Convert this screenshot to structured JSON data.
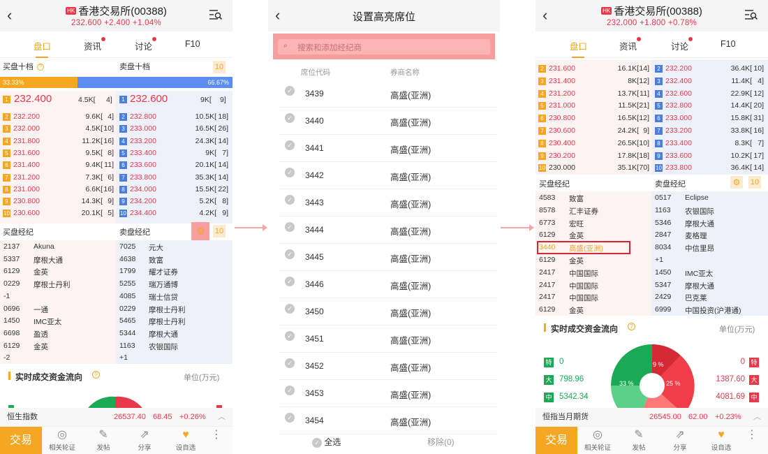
{
  "p1": {
    "title": "香港交易所(00388)",
    "hk": "HK",
    "price": "232.600",
    "change": "+2.400",
    "pct": "+1.04%",
    "tabs": [
      "盘口",
      "资讯",
      "讨论",
      "F10"
    ],
    "bid10": "买盘十档",
    "ask10": "卖盘十档",
    "levels": "10",
    "bidpct": "33.33%",
    "askpct": "66.67%",
    "top": {
      "bid": "232.400",
      "bidvol": "4.5K[",
      "bidn": "4]",
      "ask": "232.600",
      "askvol": "9K[",
      "askn": "9]"
    },
    "bids": [
      [
        "2",
        "232.200",
        "9.6K[",
        "4]"
      ],
      [
        "3",
        "232.000",
        "4.5K[",
        "10]"
      ],
      [
        "4",
        "231.800",
        "11.2K[",
        "16]"
      ],
      [
        "5",
        "231.600",
        "9.5K[",
        "8]"
      ],
      [
        "6",
        "231.400",
        "9.4K[",
        "11]"
      ],
      [
        "7",
        "231.200",
        "7.3K[",
        "6]"
      ],
      [
        "8",
        "231.000",
        "6.6K[",
        "16]"
      ],
      [
        "9",
        "230.800",
        "14.3K[",
        "9]"
      ],
      [
        "10",
        "230.600",
        "20.1K[",
        "5]"
      ]
    ],
    "asks": [
      [
        "2",
        "232.800",
        "10.5K[",
        "18]"
      ],
      [
        "3",
        "233.000",
        "16.5K[",
        "26]"
      ],
      [
        "4",
        "233.200",
        "24.3K[",
        "14]"
      ],
      [
        "5",
        "233.400",
        "9K[",
        "7]"
      ],
      [
        "6",
        "233.600",
        "20.1K[",
        "14]"
      ],
      [
        "7",
        "233.800",
        "35.3K[",
        "14]"
      ],
      [
        "8",
        "234.000",
        "15.5K[",
        "22]"
      ],
      [
        "9",
        "234.200",
        "5.2K[",
        "8]"
      ],
      [
        "10",
        "234.400",
        "4.2K[",
        "9]"
      ]
    ],
    "broker_bid": "买盘经纪",
    "broker_ask": "卖盘经纪",
    "bidBrokers": [
      [
        "2137",
        "Akuna"
      ],
      [
        "5337",
        "摩根大通"
      ],
      [
        "6129",
        "金英"
      ],
      [
        "0229",
        "摩根士丹利"
      ],
      [
        "-1",
        ""
      ],
      [
        "0696",
        "一通"
      ],
      [
        "1450",
        "IMC亚太"
      ],
      [
        "6698",
        "盈透"
      ],
      [
        "6129",
        "金英"
      ],
      [
        "-2",
        ""
      ]
    ],
    "askBrokers": [
      [
        "7025",
        "元大"
      ],
      [
        "4638",
        "致富"
      ],
      [
        "1799",
        "耀才证券"
      ],
      [
        "5255",
        "瑞万通博"
      ],
      [
        "4085",
        "瑞士信贷"
      ],
      [
        "0229",
        "摩根士丹利"
      ],
      [
        "5465",
        "摩根士丹利"
      ],
      [
        "5344",
        "摩根大通"
      ],
      [
        "1163",
        "农银国际"
      ],
      [
        "+1",
        ""
      ]
    ],
    "flow": "实时成交资金流向",
    "unit": "单位(万元)",
    "ticker": {
      "name": "恒生指数",
      "val": "26537.40",
      "chg": "68.45",
      "pct": "+0.26%"
    },
    "toolbar": {
      "trade": "交易",
      "items": [
        "相关轮证",
        "发帖",
        "分享",
        "设自选"
      ]
    }
  },
  "p2": {
    "title": "设置高亮席位",
    "search": "搜索和添加经纪商",
    "col1": "席位代码",
    "col2": "券商名称",
    "rows": [
      [
        "3439",
        "高盛(亚洲)"
      ],
      [
        "3440",
        "高盛(亚洲)"
      ],
      [
        "3441",
        "高盛(亚洲)"
      ],
      [
        "3442",
        "高盛(亚洲)"
      ],
      [
        "3443",
        "高盛(亚洲)"
      ],
      [
        "3444",
        "高盛(亚洲)"
      ],
      [
        "3445",
        "高盛(亚洲)"
      ],
      [
        "3446",
        "高盛(亚洲)"
      ],
      [
        "3450",
        "高盛(亚洲)"
      ],
      [
        "3451",
        "高盛(亚洲)"
      ],
      [
        "3452",
        "高盛(亚洲)"
      ],
      [
        "3453",
        "高盛(亚洲)"
      ],
      [
        "3454",
        "高盛(亚洲)"
      ]
    ],
    "selectall": "全选",
    "remove": "移除(0)"
  },
  "p3": {
    "title": "香港交易所(00388)",
    "hk": "HK",
    "price": "232.000",
    "change": "+1.800",
    "pct": "+0.78%",
    "tabs": [
      "盘口",
      "资讯",
      "讨论",
      "F10"
    ],
    "bids": [
      [
        "2",
        "231.600",
        "16.1K[",
        "14]"
      ],
      [
        "3",
        "231.400",
        "8K[",
        "12]"
      ],
      [
        "4",
        "231.200",
        "13.7K[",
        "11]"
      ],
      [
        "5",
        "231.000",
        "11.5K[",
        "21]"
      ],
      [
        "6",
        "230.800",
        "16.5K[",
        "12]"
      ],
      [
        "7",
        "230.600",
        "24.2K[",
        "9]"
      ],
      [
        "8",
        "230.400",
        "26.5K[",
        "10]"
      ],
      [
        "9",
        "230.200",
        "17.8K[",
        "18]"
      ],
      [
        "10",
        "230.000",
        "35.1K[",
        "70]"
      ]
    ],
    "asks": [
      [
        "2",
        "232.200",
        "36.4K[",
        "10]"
      ],
      [
        "3",
        "232.400",
        "11.4K[",
        "4]"
      ],
      [
        "4",
        "232.600",
        "22.9K[",
        "12]"
      ],
      [
        "5",
        "232.800",
        "14.4K[",
        "20]"
      ],
      [
        "6",
        "233.000",
        "15.8K[",
        "31]"
      ],
      [
        "7",
        "233.200",
        "33.8K[",
        "16]"
      ],
      [
        "8",
        "233.400",
        "8.3K[",
        "7]"
      ],
      [
        "9",
        "233.600",
        "10.2K[",
        "17]"
      ],
      [
        "10",
        "233.800",
        "36.4K[",
        "14]"
      ]
    ],
    "broker_bid": "买盘经纪",
    "broker_ask": "卖盘经纪",
    "levels": "10",
    "bidBrokers": [
      [
        "4583",
        "致富"
      ],
      [
        "8578",
        "汇丰证券"
      ],
      [
        "6773",
        "宏旺"
      ],
      [
        "6129",
        "金英"
      ],
      [
        "3440",
        "高盛(亚洲)"
      ],
      [
        "6129",
        "金英"
      ],
      [
        "2417",
        "中国国际"
      ],
      [
        "2417",
        "中国国际"
      ],
      [
        "2417",
        "中国国际"
      ],
      [
        "6129",
        "金英"
      ]
    ],
    "askBrokers": [
      [
        "0517",
        "Eclipse"
      ],
      [
        "1163",
        "农银国际"
      ],
      [
        "5346",
        "摩根大通"
      ],
      [
        "2847",
        "麦格理"
      ],
      [
        "8034",
        "中信里昂"
      ],
      [
        "+1",
        ""
      ],
      [
        "1450",
        "IMC亚太"
      ],
      [
        "5347",
        "摩根大通"
      ],
      [
        "2429",
        "巴克莱"
      ],
      [
        "6999",
        "中国投资(沪港通)"
      ]
    ],
    "flow": "实时成交资金流向",
    "unit": "单位(万元)",
    "left": [
      [
        "特",
        "0"
      ],
      [
        "大",
        "798.96"
      ],
      [
        "中",
        "5342.34"
      ]
    ],
    "right": [
      [
        "0",
        "特"
      ],
      [
        "1387.60",
        "大"
      ],
      [
        "4081.69",
        "中"
      ]
    ],
    "pie": [
      "9 %",
      "25 %",
      "33 %"
    ],
    "ticker": {
      "name": "恒指当月期货",
      "val": "26545.00",
      "chg": "62.00",
      "pct": "+0.23%"
    },
    "toolbar": {
      "trade": "交易",
      "items": [
        "相关轮证",
        "发帖",
        "分享",
        "设自选"
      ]
    }
  }
}
